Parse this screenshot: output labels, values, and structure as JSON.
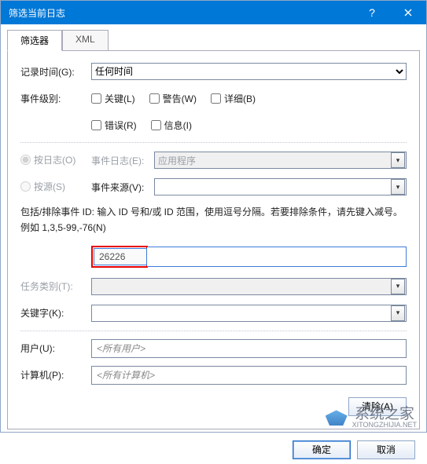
{
  "title": "筛选当前日志",
  "tabs": {
    "filter": "筛选器",
    "xml": "XML"
  },
  "labels": {
    "logged": "记录时间(G):",
    "level": "事件级别:",
    "byLog": "按日志(O)",
    "bySource": "按源(S)",
    "eventLog": "事件日志(E):",
    "eventSource": "事件来源(V):",
    "task": "任务类别(T):",
    "keyword": "关键字(K):",
    "user": "用户(U):",
    "computer": "计算机(P):"
  },
  "values": {
    "loggedAny": "任何时间",
    "eventLogVal": "应用程序",
    "eventSourceVal": "",
    "eventId": "26226",
    "taskVal": "",
    "keywordVal": "",
    "userVal": "<所有用户>",
    "computerVal": "<所有计算机>"
  },
  "checkboxes": {
    "critical": "关键(L)",
    "warning": "警告(W)",
    "verbose": "详细(B)",
    "error": "错误(R)",
    "info": "信息(I)"
  },
  "help": "包括/排除事件 ID: 输入 ID 号和/或 ID 范围，使用逗号分隔。若要排除条件，请先键入减号。例如 1,3,5-99,-76(N)",
  "buttons": {
    "clear": "清除(A)",
    "ok": "确定",
    "cancel": "取消"
  },
  "watermark": {
    "text": "系统之家",
    "sub": "XITONGZHIJIA.NET"
  }
}
